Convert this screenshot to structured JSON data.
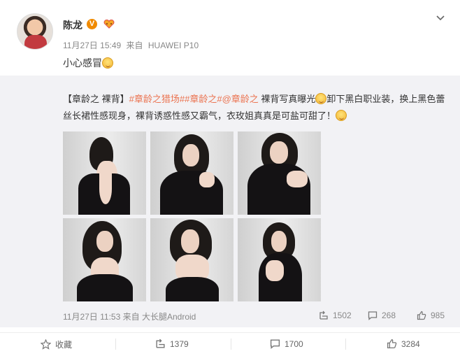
{
  "post": {
    "author": "陈龙",
    "verified_badge": "V",
    "date": "11月27日 15:49",
    "source_prefix": "来自",
    "device": "HUAWEI P10",
    "text": "小心感冒"
  },
  "repost": {
    "prefix": "【章龄之 裸背】",
    "hashtags": [
      "#章龄之猎场#",
      "#章龄之#"
    ],
    "mention": "@章龄之",
    "text_a": " 裸背写真曝光",
    "text_b": "卸下黑白职业装，换上黑色蕾丝长裙性感现身，裸背诱惑性感又霸气，衣玫姐真真是可盐可甜了！",
    "date": "11月27日 11:53",
    "source_prefix": "来自",
    "device": "大长腿Android",
    "reposts": "1502",
    "comments": "268",
    "likes": "985"
  },
  "actions": {
    "favorite": "收藏",
    "repost": "1379",
    "comment": "1700",
    "like": "3284"
  },
  "icons": [
    "chevron-down-icon",
    "heart-badge-icon",
    "smile-emoji-icon",
    "repost-icon",
    "comment-icon",
    "like-icon",
    "star-icon"
  ],
  "colors": {
    "hashtag": "#eb7350",
    "badge": "#f08a00",
    "repost_bg": "#f2f2f5"
  }
}
